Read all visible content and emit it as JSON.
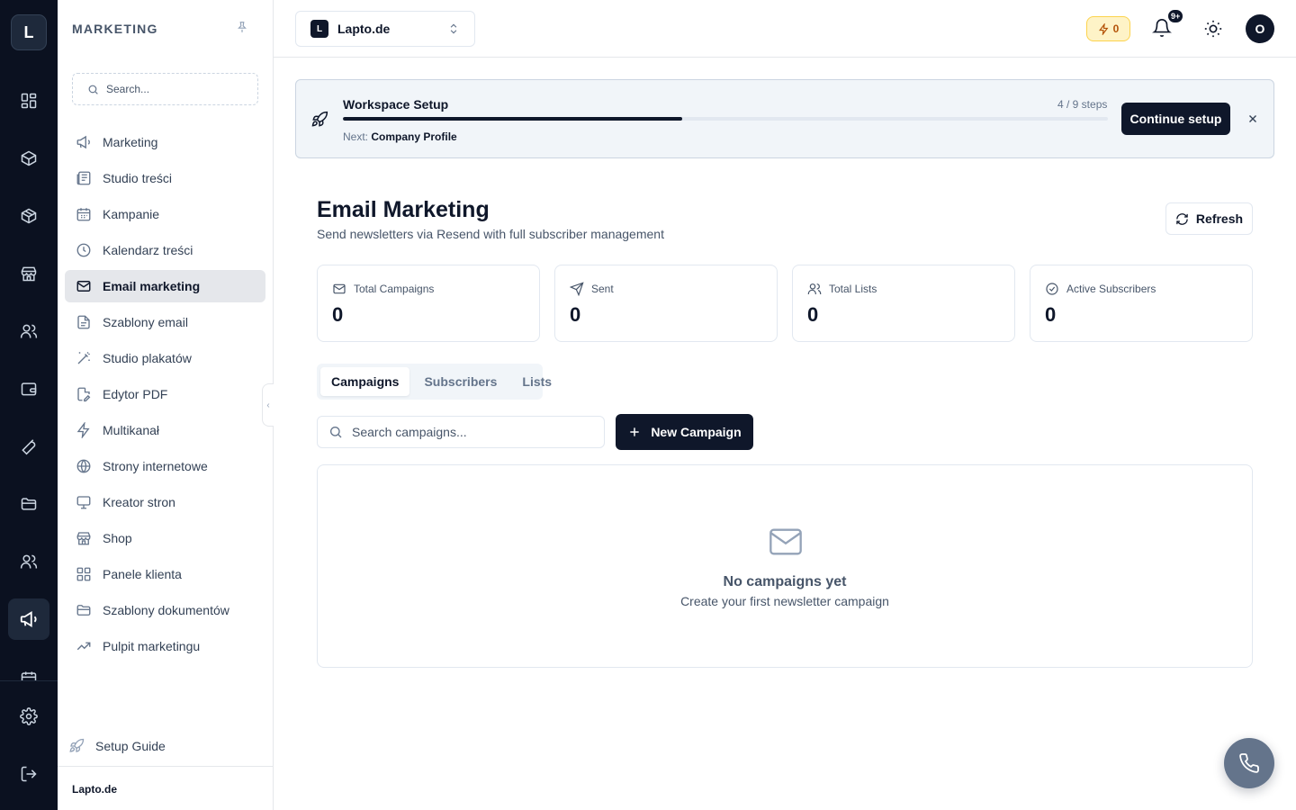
{
  "rail": {
    "logo_letter": "L"
  },
  "sidebar": {
    "section_title": "MARKETING",
    "search_placeholder": "Search...",
    "items": [
      {
        "label": "Marketing",
        "icon": "megaphone-icon"
      },
      {
        "label": "Studio treści",
        "icon": "newspaper-icon"
      },
      {
        "label": "Kampanie",
        "icon": "calendar-icon"
      },
      {
        "label": "Kalendarz treści",
        "icon": "clock-icon"
      },
      {
        "label": "Email marketing",
        "icon": "mail-icon",
        "active": true
      },
      {
        "label": "Szablony email",
        "icon": "file-text-icon"
      },
      {
        "label": "Studio plakatów",
        "icon": "wand-icon"
      },
      {
        "label": "Edytor PDF",
        "icon": "file-edit-icon"
      },
      {
        "label": "Multikanał",
        "icon": "zap-icon"
      },
      {
        "label": "Strony internetowe",
        "icon": "globe-icon"
      },
      {
        "label": "Kreator stron",
        "icon": "monitor-icon"
      },
      {
        "label": "Shop",
        "icon": "store-icon"
      },
      {
        "label": "Panele klienta",
        "icon": "grid-icon"
      },
      {
        "label": "Szablony dokumentów",
        "icon": "folder-icon"
      },
      {
        "label": "Pulpit marketingu",
        "icon": "trending-up-icon"
      }
    ],
    "setup_guide": "Setup Guide",
    "footer_workspace": "Lapto.de"
  },
  "topbar": {
    "workspace_badge": "L",
    "workspace_name": "Lapto.de",
    "credits": "0",
    "notifications_badge": "9+",
    "avatar_letter": "O"
  },
  "banner": {
    "title": "Workspace Setup",
    "steps": "4 / 9 steps",
    "progress": 0.444,
    "next_prefix": "Next:",
    "next_step": "Company Profile",
    "continue_label": "Continue setup"
  },
  "page": {
    "title": "Email Marketing",
    "subtitle": "Send newsletters via Resend with full subscriber management",
    "refresh_label": "Refresh"
  },
  "stats": [
    {
      "label": "Total Campaigns",
      "value": "0",
      "icon": "mail-icon"
    },
    {
      "label": "Sent",
      "value": "0",
      "icon": "send-icon"
    },
    {
      "label": "Total Lists",
      "value": "0",
      "icon": "users-icon"
    },
    {
      "label": "Active Subscribers",
      "value": "0",
      "icon": "check-circle-icon"
    }
  ],
  "tabs": [
    {
      "label": "Campaigns",
      "active": true
    },
    {
      "label": "Subscribers"
    },
    {
      "label": "Lists"
    }
  ],
  "campaigns": {
    "search_placeholder": "Search campaigns...",
    "new_label": "New Campaign",
    "empty_title": "No campaigns yet",
    "empty_subtitle": "Create your first newsletter campaign"
  },
  "colors": {
    "rail_bg": "#0b1120",
    "primary": "#0f172a",
    "credits_bg": "#fef3c7",
    "credits_text": "#b45309",
    "fab_bg": "#64748b"
  }
}
